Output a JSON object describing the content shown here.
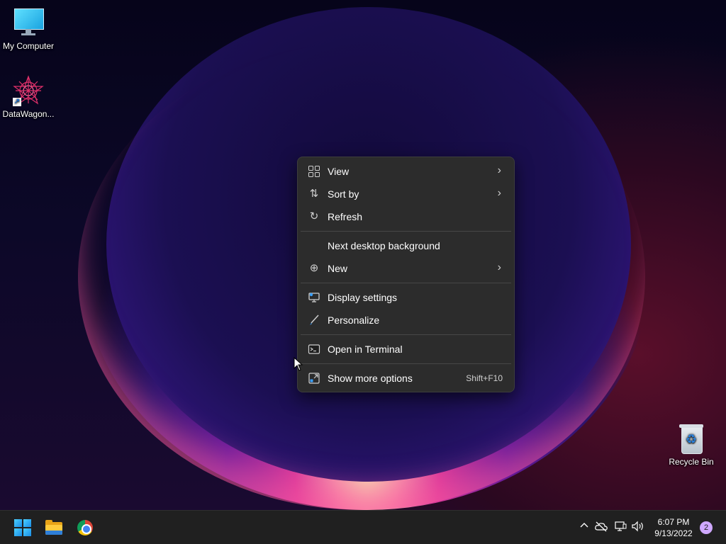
{
  "desktop": {
    "icons": [
      {
        "label": "My Computer",
        "icon": "monitor-icon"
      },
      {
        "label": "DataWagon...",
        "icon": "datawagon-app-icon"
      },
      {
        "label": "Recycle Bin",
        "icon": "recycle-bin-icon"
      }
    ]
  },
  "context_menu": {
    "items": [
      {
        "label": "View",
        "icon": "view-grid-icon",
        "submenu": true
      },
      {
        "label": "Sort by",
        "icon": "sort-icon",
        "submenu": true
      },
      {
        "label": "Refresh",
        "icon": "refresh-icon",
        "submenu": false
      },
      {
        "label": "Next desktop background",
        "icon": "",
        "submenu": false
      },
      {
        "label": "New",
        "icon": "plus-circle-icon",
        "submenu": true
      },
      {
        "label": "Display settings",
        "icon": "display-settings-icon",
        "submenu": false
      },
      {
        "label": "Personalize",
        "icon": "brush-icon",
        "submenu": false
      },
      {
        "label": "Open in Terminal",
        "icon": "terminal-icon",
        "submenu": false
      },
      {
        "label": "Show more options",
        "icon": "more-options-icon",
        "shortcut": "Shift+F10"
      }
    ]
  },
  "taskbar": {
    "apps": [
      {
        "name": "Start",
        "icon": "windows-start-icon"
      },
      {
        "name": "File Explorer",
        "icon": "file-explorer-icon"
      },
      {
        "name": "Google Chrome",
        "icon": "chrome-icon"
      }
    ],
    "tray": {
      "icons": [
        "chevron-up-icon",
        "onedrive-offline-icon",
        "network-icon",
        "volume-icon"
      ],
      "time": "6:07 PM",
      "date": "9/13/2022",
      "notifications": "2"
    }
  }
}
